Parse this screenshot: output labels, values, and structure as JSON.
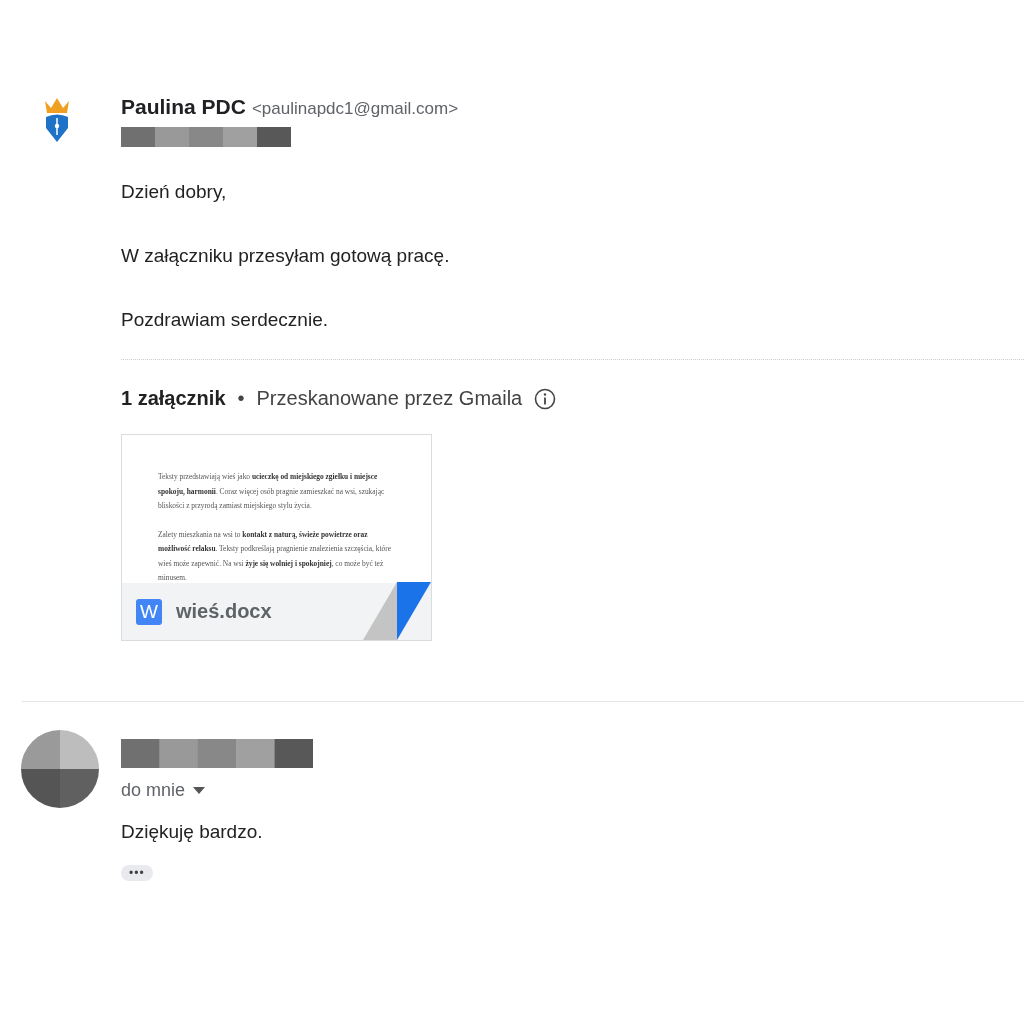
{
  "message": {
    "sender": {
      "name": "Paulina PDC",
      "email": "<paulinapdc1@gmail.com>"
    },
    "body": [
      "Dzień dobry,",
      "W załączniku przesyłam gotową pracę.",
      "Pozdrawiam serdecznie."
    ],
    "attachments_header": {
      "count": "1 załącznik",
      "separator": "•",
      "scan_note": "Przeskanowane przez Gmaila"
    },
    "attachments": [
      {
        "preview": [
          "Teksty przedstawiają wieś jako **ucieczkę od miejskiego zgiełku i miejsce spokoju, harmonii**. Coraz więcej osób pragnie zamieszkać na wsi, szukając bliskości z przyrodą zamiast miejskiego stylu życia.",
          "Zalety mieszkania na wsi to **kontakt z naturą, świeże powietrze oraz możliwość relaksu**. Teksty podkreślają pragnienie znalezienia szczęścia, które wieś może zapewnić. Na wsi **żyje się wolniej i spokojniej**, co może być też minusem."
        ],
        "filename": "wieś.docx",
        "file_icon": "W"
      }
    ]
  },
  "reply": {
    "recipient": "do mnie",
    "body": [
      "Dziękuję bardzo."
    ],
    "collapsed_quote": "•••"
  }
}
